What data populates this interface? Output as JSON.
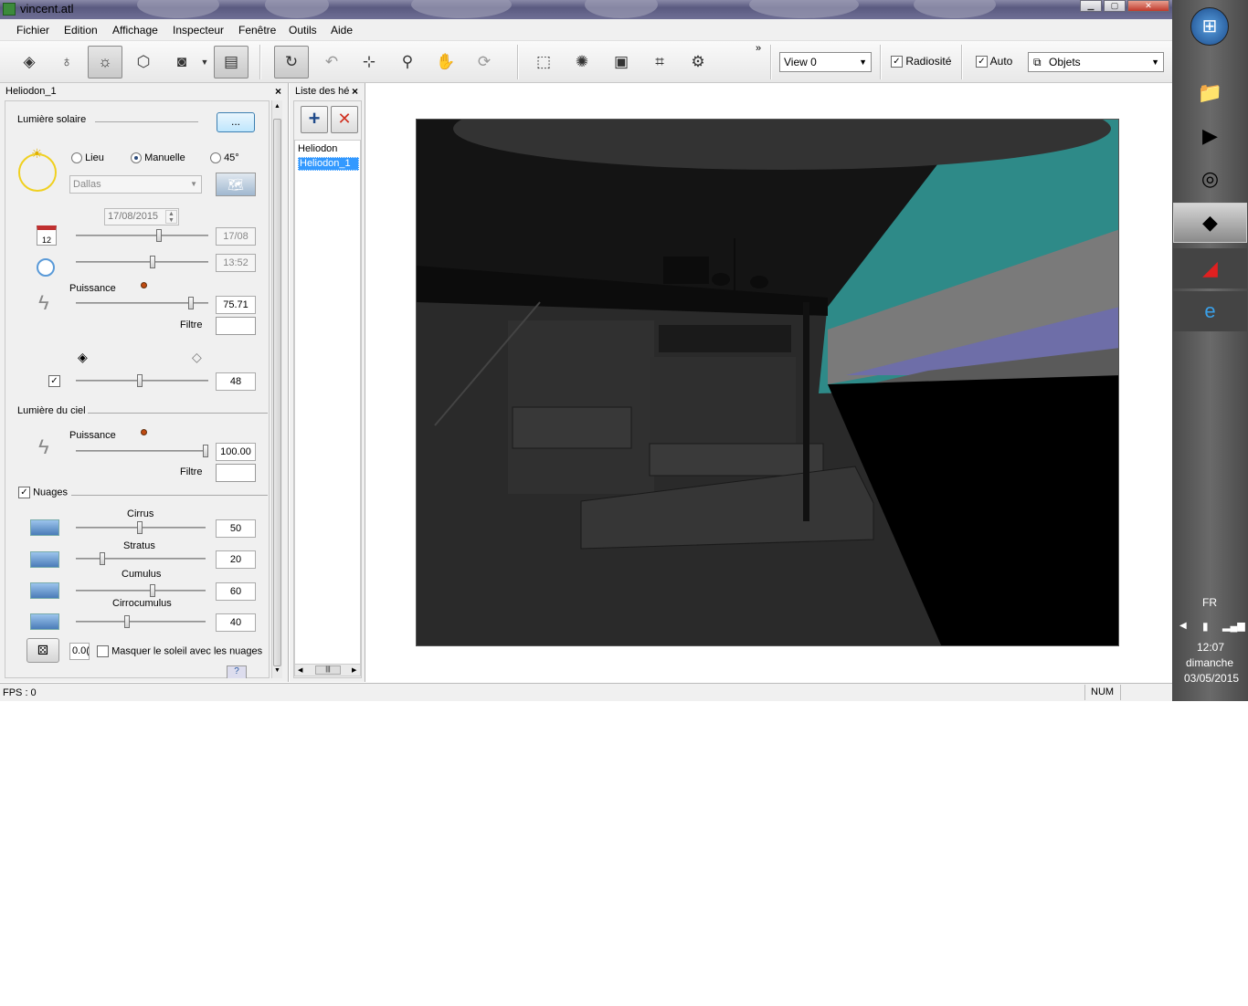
{
  "window": {
    "title": "vincent.atl"
  },
  "menu": [
    "Fichier",
    "Edition",
    "Affichage",
    "Inspecteur",
    "Fenêtre",
    "Outils",
    "Aide"
  ],
  "toolbar": {
    "view_select": "View 0",
    "radiosite_label": "Radiosité",
    "radiosite_checked": true,
    "auto_label": "Auto",
    "auto_checked": true,
    "objets_select": "Objets",
    "overflow": "»"
  },
  "left_panel": {
    "title": "Heliodon_1",
    "sun_section": "Lumière solaire",
    "more_button": "...",
    "mode_options": {
      "lieu": "Lieu",
      "manuelle": "Manuelle",
      "deg45": "45°"
    },
    "mode_selected": "Manuelle",
    "location_select": "Dallas",
    "date_field": "17/08/2015",
    "calendar_day": "12",
    "date_short": "17/08",
    "time_value": "13:52",
    "sun_power_label": "Puissance",
    "sun_power_value": "75.71",
    "filter_label": "Filtre",
    "shadow_value": "48",
    "sky_section": "Lumière du ciel",
    "sky_power_label": "Puissance",
    "sky_power_value": "100.00",
    "sky_filter_label": "Filtre",
    "clouds_label": "Nuages",
    "clouds_checked": true,
    "clouds": [
      {
        "name": "Cirrus",
        "value": "50"
      },
      {
        "name": "Stratus",
        "value": "20"
      },
      {
        "name": "Cumulus",
        "value": "60"
      },
      {
        "name": "Cirrocumulus",
        "value": "40"
      }
    ],
    "seed_value": "0.0(",
    "hide_sun_label": "Masquer le soleil avec les nuages"
  },
  "list_panel": {
    "title": "Liste des hé",
    "items": [
      "Heliodon",
      "Heliodon_1"
    ],
    "selected": "Heliodon_1"
  },
  "status": {
    "fps": "FPS : 0",
    "num": "NUM"
  },
  "taskbar": {
    "lang": "FR",
    "time": "12:07",
    "day": "dimanche",
    "date": "03/05/2015"
  },
  "colors": {
    "selection": "#3399ff",
    "sky_teal": "#2e8c8a",
    "sky_violet": "#6e6ea8",
    "scene_dark": "#2a2a2a"
  }
}
